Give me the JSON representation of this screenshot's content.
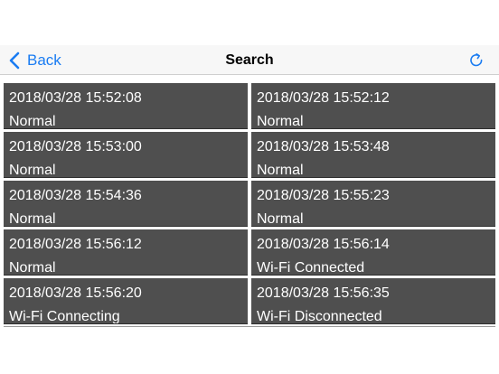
{
  "nav": {
    "back_label": "Back",
    "title": "Search"
  },
  "records": [
    {
      "timestamp": "2018/03/28 15:52:08",
      "status": "Normal"
    },
    {
      "timestamp": "2018/03/28 15:52:12",
      "status": "Normal"
    },
    {
      "timestamp": "2018/03/28 15:53:00",
      "status": "Normal"
    },
    {
      "timestamp": "2018/03/28 15:53:48",
      "status": "Normal"
    },
    {
      "timestamp": "2018/03/28 15:54:36",
      "status": "Normal"
    },
    {
      "timestamp": "2018/03/28 15:55:23",
      "status": "Normal"
    },
    {
      "timestamp": "2018/03/28 15:56:12",
      "status": "Normal"
    },
    {
      "timestamp": "2018/03/28 15:56:14",
      "status": "Wi-Fi Connected"
    },
    {
      "timestamp": "2018/03/28 15:56:20",
      "status": "Wi-Fi Connecting"
    },
    {
      "timestamp": "2018/03/28 15:56:35",
      "status": "Wi-Fi Disconnected"
    }
  ],
  "icons": {
    "back": "chevron-left-icon",
    "refresh": "refresh-icon"
  },
  "colors": {
    "accent": "#1a7cf2",
    "cell_background": "#4f4f4f",
    "cell_text": "#ffffff",
    "nav_background": "#f7f7f7"
  }
}
